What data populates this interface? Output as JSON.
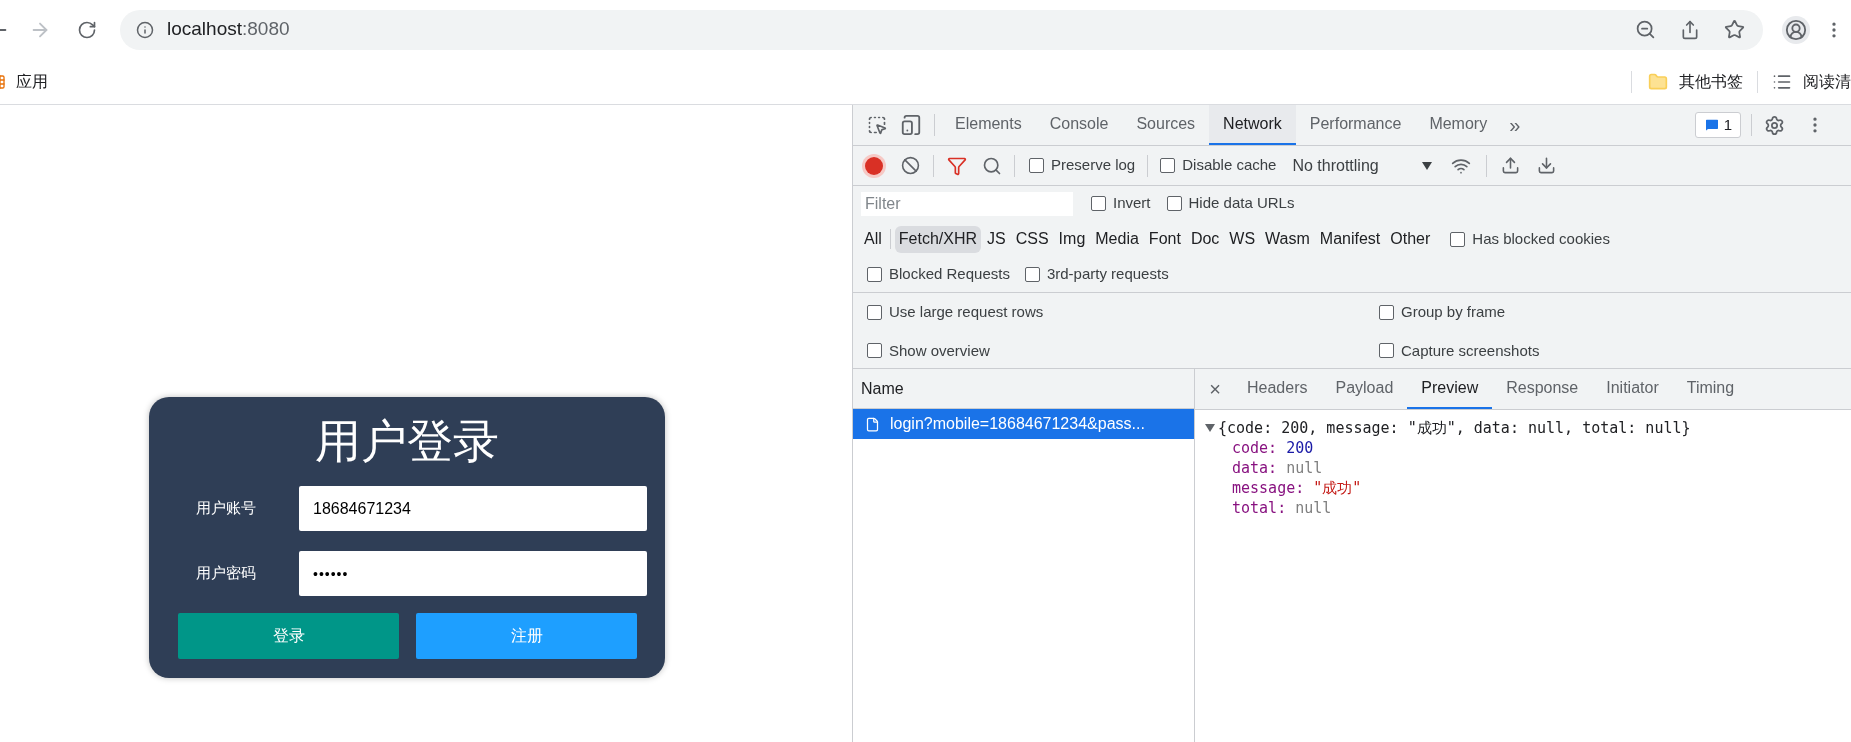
{
  "browser": {
    "address": {
      "host": "localhost",
      "port": ":8080"
    },
    "bookmarks": {
      "apps": "应用",
      "right": [
        "其他书签",
        "阅读清"
      ]
    }
  },
  "page": {
    "login": {
      "title": "用户登录",
      "fields": [
        {
          "label": "用户账号",
          "value": "18684671234",
          "kind": "text"
        },
        {
          "label": "用户密码",
          "value": "••••••",
          "kind": "password"
        }
      ],
      "buttons": [
        {
          "label": "登录",
          "color": "#009688"
        },
        {
          "label": "注册",
          "color": "#1e9fff"
        }
      ]
    }
  },
  "devtools": {
    "tabs": [
      {
        "label": "Elements",
        "selected": false
      },
      {
        "label": "Console",
        "selected": false
      },
      {
        "label": "Sources",
        "selected": false
      },
      {
        "label": "Network",
        "selected": true
      },
      {
        "label": "Performance",
        "selected": false
      },
      {
        "label": "Memory",
        "selected": false
      }
    ],
    "overflow": "»",
    "issues": "1",
    "toolbar": {
      "recording": true,
      "preserve_log": {
        "label": "Preserve log",
        "checked": false
      },
      "disable_cache": {
        "label": "Disable cache",
        "checked": false
      },
      "throttling": "No throttling"
    },
    "filter": {
      "placeholder": "Filter",
      "invert": {
        "label": "Invert",
        "checked": false
      },
      "hide_data_urls": {
        "label": "Hide data URLs",
        "checked": false
      }
    },
    "types": [
      {
        "label": "All",
        "selected": false
      },
      {
        "label": "Fetch/XHR",
        "selected": true
      },
      {
        "label": "JS",
        "selected": false
      },
      {
        "label": "CSS",
        "selected": false
      },
      {
        "label": "Img",
        "selected": false
      },
      {
        "label": "Media",
        "selected": false
      },
      {
        "label": "Font",
        "selected": false
      },
      {
        "label": "Doc",
        "selected": false
      },
      {
        "label": "WS",
        "selected": false
      },
      {
        "label": "Wasm",
        "selected": false
      },
      {
        "label": "Manifest",
        "selected": false
      },
      {
        "label": "Other",
        "selected": false
      }
    ],
    "has_blocked_cookies": {
      "label": "Has blocked cookies",
      "checked": false
    },
    "blocked_requests": {
      "label": "Blocked Requests",
      "checked": false
    },
    "third_party": {
      "label": "3rd-party requests",
      "checked": false
    },
    "settings": [
      {
        "label": "Use large request rows",
        "checked": false
      },
      {
        "label": "Group by frame",
        "checked": false
      },
      {
        "label": "Show overview",
        "checked": false
      },
      {
        "label": "Capture screenshots",
        "checked": false
      }
    ],
    "requests": {
      "column": "Name",
      "rows": [
        {
          "name": "login?mobile=18684671234&pass...",
          "selected": true
        }
      ]
    },
    "detail": {
      "close": "×",
      "tabs": [
        {
          "label": "Headers",
          "selected": false
        },
        {
          "label": "Payload",
          "selected": false
        },
        {
          "label": "Preview",
          "selected": true
        },
        {
          "label": "Response",
          "selected": false
        },
        {
          "label": "Initiator",
          "selected": false
        },
        {
          "label": "Timing",
          "selected": false
        }
      ],
      "preview": {
        "expanded": true,
        "summary": "{code: 200, message: \"成功\", data: null, total: null}",
        "properties": [
          {
            "key": "code:",
            "value": "200",
            "kind": "number"
          },
          {
            "key": "data:",
            "value": "null",
            "kind": "null"
          },
          {
            "key": "message:",
            "value": "\"成功\"",
            "kind": "string"
          },
          {
            "key": "total:",
            "value": "null",
            "kind": "null"
          }
        ]
      }
    }
  }
}
